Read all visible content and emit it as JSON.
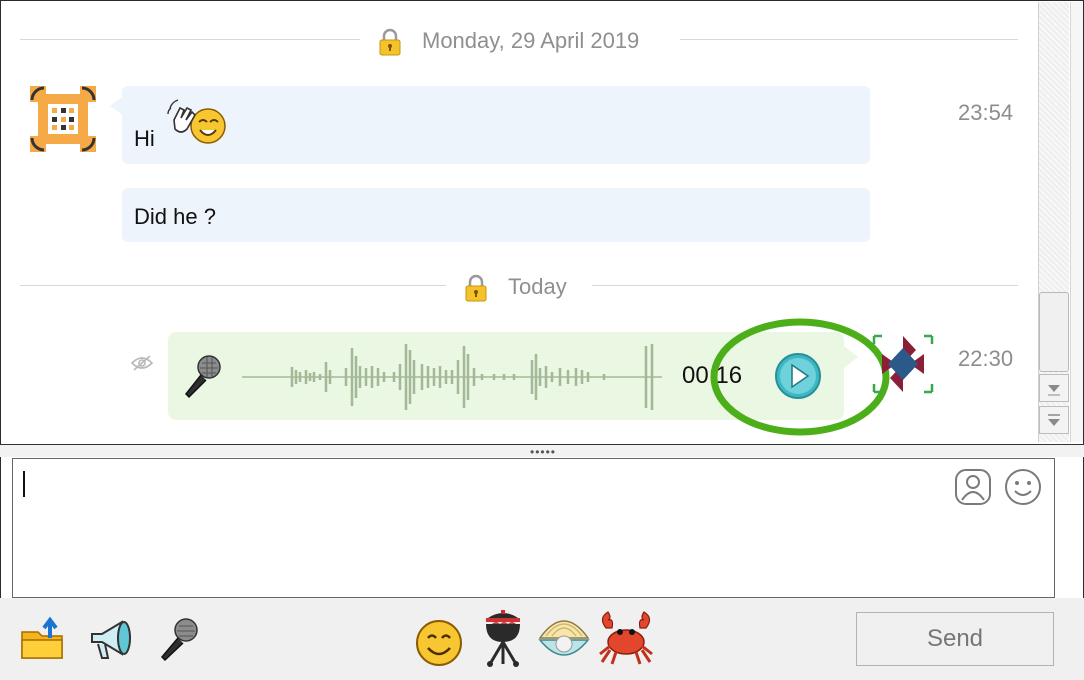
{
  "chat": {
    "separators": [
      {
        "label": "Monday, 29 April 2019"
      },
      {
        "label": "Today"
      }
    ],
    "messages": [
      {
        "text": "Hi",
        "time": "23:54"
      },
      {
        "text": "Did he ?"
      }
    ],
    "voice_message": {
      "duration": "00:16",
      "time": "22:30"
    }
  },
  "composer": {
    "send_label": "Send"
  },
  "icons": {
    "lock": "lock-icon",
    "waving_face": "waving-face-emoji",
    "unread_status": "eye-slash-icon",
    "microphone": "microphone-icon",
    "play": "play-icon",
    "contact": "contact-card-icon",
    "emoji_picker": "smiley-icon",
    "send_file": "send-file-icon",
    "broadcast": "megaphone-icon",
    "voice_record": "microphone-icon",
    "emoji_strip": [
      "smiling-face-emoji",
      "barbecue-grill-emoji",
      "oyster-pearl-emoji",
      "crab-emoji"
    ]
  },
  "colors": {
    "incoming_bubble": "#eef4fb",
    "voice_bubble": "#eaf7e3",
    "waveform": "#a4b797",
    "highlight_ring": "#4caf1a",
    "play_button": "#3cb8c4"
  }
}
